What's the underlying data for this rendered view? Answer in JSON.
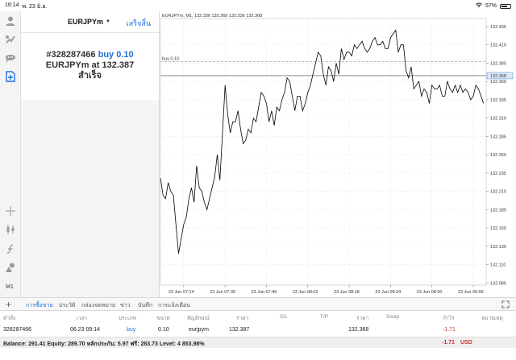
{
  "status_bar": {
    "time": "16:14",
    "date": "พ. 23 มิ.ย.",
    "battery": "57%",
    "battery_level": 0.57
  },
  "toolbar": {
    "mode_label": "M1"
  },
  "trade_panel": {
    "symbol": "EURJPYm",
    "done_label": "เสร็จสิ้น",
    "order_number": "#328287466",
    "order_side": "buy 0.10",
    "symbol_line": "EURJPYm at",
    "price": "132.387",
    "status": "สำเร็จ"
  },
  "chart_data": {
    "type": "line",
    "title": "EURJPYm, M1, 132.336 132.368 132.336 132.368",
    "order_line_label": "buy 0.10",
    "order_line_price": 132.387,
    "current_price": 132.368,
    "current_price_label": "132.368",
    "ylim": [
      132.082,
      132.446
    ],
    "y_ticks": [
      "132.435",
      "132.410",
      "132.385",
      "132.360",
      "132.335",
      "132.310",
      "132.285",
      "132.260",
      "132.235",
      "132.210",
      "132.185",
      "132.160",
      "132.135",
      "132.110",
      "132.085"
    ],
    "y_tick_values": [
      132.435,
      132.41,
      132.385,
      132.36,
      132.335,
      132.31,
      132.285,
      132.26,
      132.235,
      132.21,
      132.185,
      132.16,
      132.135,
      132.11,
      132.085
    ],
    "x_ticks": [
      "23 Jun 07:14",
      "23 Jun 07:30",
      "23 Jun 07:46",
      "23 Jun 08:02",
      "23 Jun 08:18",
      "23 Jun 08:34",
      "23 Jun 08:50",
      "23 Jun 09:06"
    ],
    "x_tick_minutes": [
      434,
      450,
      466,
      482,
      498,
      514,
      530,
      546
    ],
    "xlim": [
      425,
      551
    ],
    "grid": true,
    "x": [
      425,
      426,
      427,
      428,
      429,
      430,
      431,
      432,
      433,
      434,
      435,
      436,
      437,
      438,
      439,
      440,
      441,
      442,
      443,
      444,
      445,
      446,
      447,
      448,
      449,
      450,
      451,
      452,
      453,
      454,
      455,
      456,
      457,
      458,
      459,
      460,
      461,
      462,
      463,
      464,
      465,
      466,
      467,
      468,
      469,
      470,
      471,
      472,
      473,
      474,
      475,
      476,
      477,
      478,
      479,
      480,
      481,
      482,
      483,
      484,
      485,
      486,
      487,
      488,
      489,
      490,
      491,
      492,
      493,
      494,
      495,
      496,
      497,
      498,
      499,
      500,
      501,
      502,
      503,
      504,
      505,
      506,
      507,
      508,
      509,
      510,
      511,
      512,
      513,
      514,
      515,
      516,
      517,
      518,
      519,
      520,
      521,
      522,
      523,
      524,
      525,
      526,
      527,
      528,
      529,
      530,
      531,
      532,
      533,
      534,
      535,
      536,
      537,
      538,
      539,
      540,
      541,
      542,
      543,
      544,
      545,
      546,
      547,
      548,
      549,
      550
    ],
    "values": [
      132.228,
      132.205,
      132.2,
      132.222,
      132.21,
      132.205,
      132.165,
      132.125,
      132.145,
      132.165,
      132.175,
      132.2,
      132.215,
      132.195,
      132.245,
      132.215,
      132.21,
      132.195,
      132.185,
      132.2,
      132.215,
      132.23,
      132.26,
      132.225,
      132.29,
      132.355,
      132.315,
      132.29,
      132.305,
      132.305,
      132.32,
      132.295,
      132.275,
      132.28,
      132.295,
      132.29,
      132.31,
      132.305,
      132.325,
      132.345,
      132.34,
      132.33,
      132.305,
      132.32,
      132.3,
      132.325,
      132.32,
      132.335,
      132.345,
      132.365,
      132.36,
      132.34,
      132.32,
      132.34,
      132.34,
      132.32,
      132.33,
      132.345,
      132.355,
      132.37,
      132.385,
      132.4,
      132.395,
      132.37,
      132.355,
      132.38,
      132.375,
      132.36,
      132.385,
      132.37,
      132.405,
      132.39,
      132.4,
      132.4,
      132.395,
      132.41,
      132.405,
      132.41,
      132.415,
      132.405,
      132.4,
      132.405,
      132.415,
      132.42,
      132.41,
      132.41,
      132.415,
      132.405,
      132.405,
      132.42,
      132.425,
      132.43,
      132.4,
      132.41,
      132.41,
      132.375,
      132.365,
      132.38,
      132.35,
      132.355,
      132.36,
      132.34,
      132.35,
      132.345,
      132.33,
      132.355,
      132.35,
      132.35,
      132.355,
      132.34,
      132.34,
      132.36,
      132.35,
      132.345,
      132.355,
      132.345,
      132.355,
      132.345,
      132.35,
      132.345,
      132.335,
      132.34,
      132.355,
      132.35,
      132.34,
      132.33,
      132.34,
      132.368
    ]
  },
  "tabs": [
    {
      "label": "การซื้อขาย"
    },
    {
      "label": "ประวัติ"
    },
    {
      "label": "กล่องจดหมาย"
    },
    {
      "label": "ข่าว"
    },
    {
      "label": "บันทึก"
    },
    {
      "label": "การแจ้งเตือน"
    }
  ],
  "table": {
    "headers": {
      "order": "คำสั่ง",
      "time": "เวลา",
      "type": "ประเภท",
      "size": "ขนาด",
      "symbol": "สัญลักษณ์",
      "price": "ราคา",
      "sl": "S/L",
      "tp": "T/P",
      "price2": "ราคา",
      "swap": "Swap",
      "profit": "กำไร",
      "comment": "หมายเหตุ"
    },
    "row": {
      "order": "328287466",
      "time": "06.23 09:14",
      "type": "buy",
      "size": "0.10",
      "symbol": "eurjpym",
      "price": "132.387",
      "price2": "132.368",
      "profit": "-1.71"
    },
    "summary": {
      "text": "Balance: 291.41  Equity: 289.70  หลักประกัน: 5.97  ฟรี: 283.73  Level: 4 853.98%",
      "profit": "-1.71",
      "currency": "USD"
    }
  },
  "colors": {
    "accent": "#1e6fd9",
    "negative": "#d9302c",
    "chart_line": "#000000",
    "grid": "#cfcfcf"
  }
}
